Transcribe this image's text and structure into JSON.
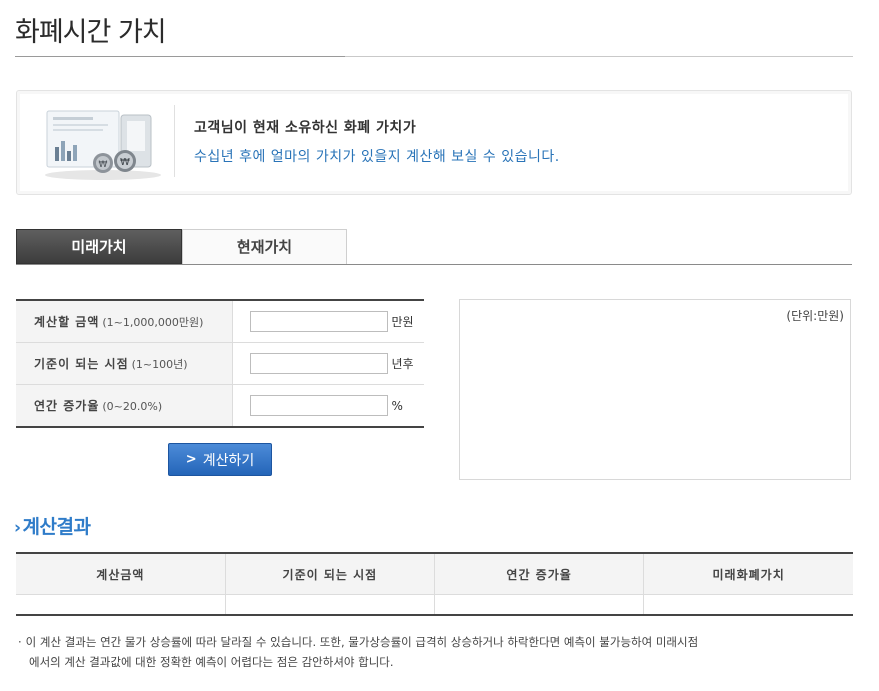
{
  "page": {
    "title": "화폐시간 가치"
  },
  "intro": {
    "line1": "고객님이 현재 소유하신 화폐 가치가",
    "line2": "수십년 후에 얼마의 가치가 있을지 계산해 보실 수 있습니다.",
    "illustration_icon": "currency-chart-illustration"
  },
  "tabs": [
    {
      "label": "미래가치",
      "active": true
    },
    {
      "label": "현재가치",
      "active": false
    }
  ],
  "form": {
    "rows": [
      {
        "label": "계산할 금액",
        "range": "(1~1,000,000만원)",
        "value": "",
        "unit": "만원"
      },
      {
        "label": "기준이 되는 시점",
        "range": "(1~100년)",
        "value": "",
        "unit": "년후"
      },
      {
        "label": "연간 증가율",
        "range": "(0~20.0%)",
        "value": "",
        "unit": "%"
      }
    ],
    "calc_button": "계산하기"
  },
  "result_panel": {
    "unit_note": "(단위:만원)"
  },
  "results": {
    "section_title": "계산결과",
    "headers": [
      "계산금액",
      "기준이 되는 시점",
      "연간 증가율",
      "미래화폐가치"
    ],
    "row": [
      "",
      "",
      "",
      ""
    ]
  },
  "notice": {
    "bullet": "·",
    "line1": "이 계산 결과는 연간 물가 상승률에 따라 달라질 수 있습니다. 또한, 물가상승률이 급격히 상승하거나 하락한다면 예측이 불가능하여 미래시점",
    "line2": "에서의 계산 결과값에 대한 정확한 예측이 어렵다는 점은 감안하셔야 합니다."
  },
  "colors": {
    "accent_blue": "#2f7cc9",
    "intro_blue": "#2a74b8",
    "button_blue": "#2465b8",
    "tab_active": "#4a4a4a"
  }
}
